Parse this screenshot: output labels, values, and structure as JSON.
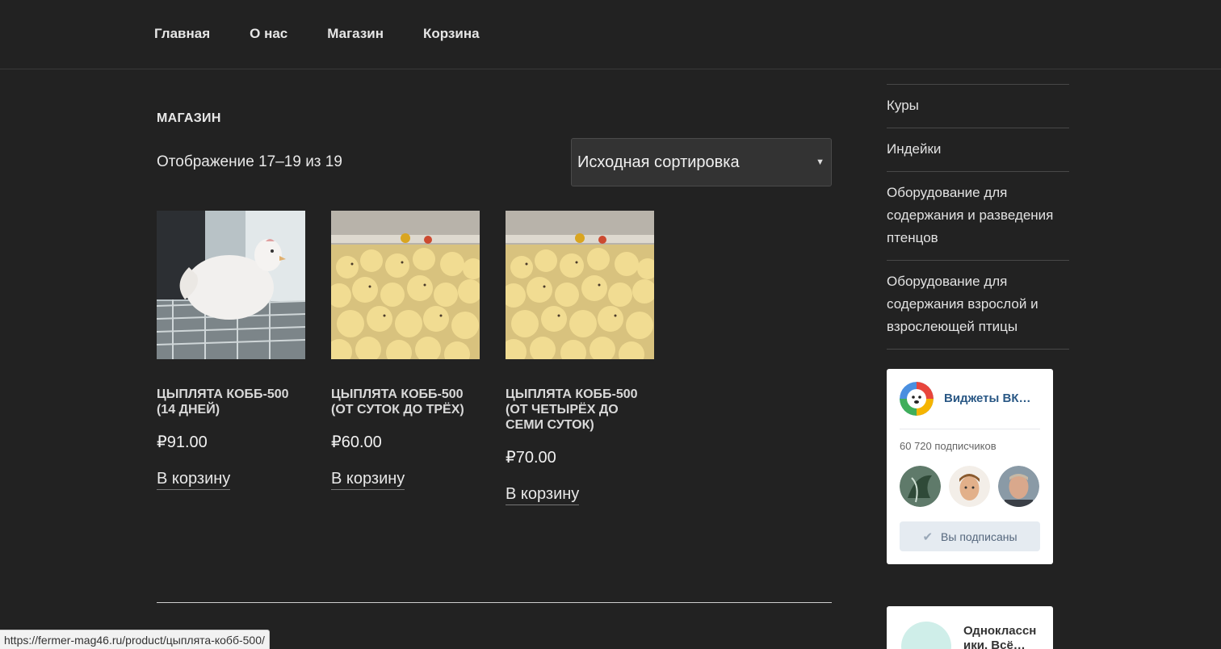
{
  "nav": {
    "items": [
      "Главная",
      "О нас",
      "Магазин",
      "Корзина"
    ]
  },
  "shop": {
    "title": "МАГАЗИН",
    "result_count": "Отображение 17–19 из 19",
    "sort": "Исходная сортировка"
  },
  "products": [
    {
      "title": "ЦЫПЛЯТА КОББ-500 (14 ДНЕЙ)",
      "price": "₽91.00",
      "cart": "В корзину"
    },
    {
      "title": "ЦЫПЛЯТА КОББ-500 (ОТ СУТОК ДО ТРЁХ)",
      "price": "₽60.00",
      "cart": "В корзину"
    },
    {
      "title": "ЦЫПЛЯТА КОББ-500 (ОТ ЧЕТЫРЁХ ДО СЕМИ СУТОК)",
      "price": "₽70.00",
      "cart": "В корзину"
    }
  ],
  "sidebar": {
    "categories": [
      "Куры",
      "Индейки",
      "Оборудование для содержания и разведения птенцов",
      "Оборудование для содержания взрослой и взрослеющей птицы"
    ]
  },
  "vk": {
    "name": "Виджеты ВК…",
    "subscribers": "60 720 подписчиков",
    "button": "Вы подписаны"
  },
  "ok": {
    "name": "Одноклассн ики. Всё…"
  },
  "status": {
    "url": "https://fermer-mag46.ru/product/цыплята-кобб-500/"
  }
}
